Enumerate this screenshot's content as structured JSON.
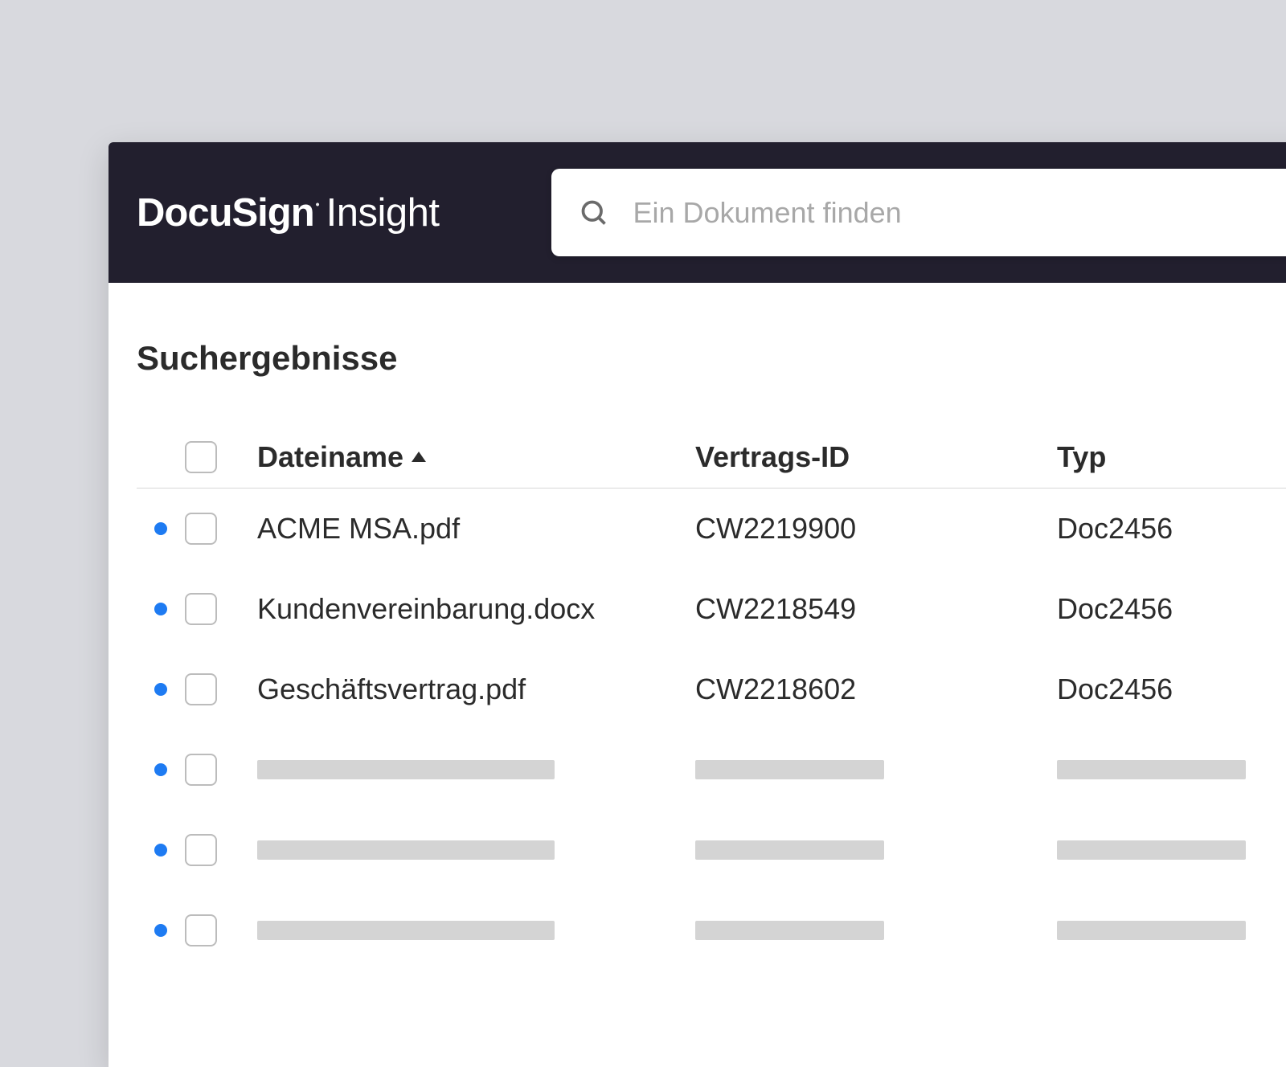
{
  "brand": {
    "name": "DocuSign",
    "product": "Insight"
  },
  "search": {
    "placeholder": "Ein Dokument finden",
    "value": ""
  },
  "results": {
    "title": "Suchergebnisse",
    "columns": {
      "filename": "Dateiname",
      "contract_id": "Vertrags-ID",
      "type": "Typ"
    },
    "sort": {
      "column": "filename",
      "direction": "asc"
    },
    "rows": [
      {
        "filename": "ACME MSA.pdf",
        "contract_id": "CW2219900",
        "type": "Doc2456",
        "unread": true
      },
      {
        "filename": "Kundenvereinbarung.docx",
        "contract_id": "CW2218549",
        "type": "Doc2456",
        "unread": true
      },
      {
        "filename": "Geschäftsvertrag.pdf",
        "contract_id": "CW2218602",
        "type": "Doc2456",
        "unread": true
      }
    ],
    "skeleton_row_count": 3
  },
  "colors": {
    "header_bg": "#221f2e",
    "accent_dot": "#1e7bf2",
    "skeleton": "#d4d4d4"
  }
}
